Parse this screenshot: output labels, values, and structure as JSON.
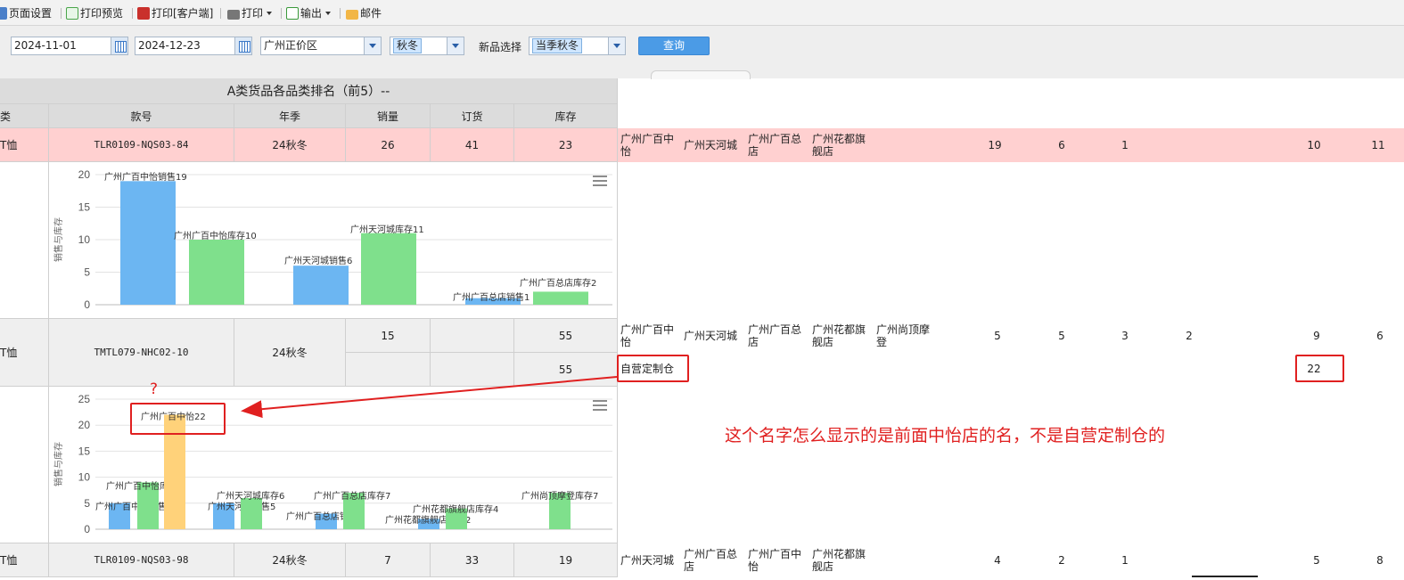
{
  "toolbar": {
    "page_setup": "页面设置",
    "print_preview": "打印预览",
    "print_client": "打印[客户端]",
    "print": "打印",
    "export": "输出",
    "mail": "邮件"
  },
  "filters": {
    "date_from": "2024-11-01",
    "date_to": "2024-12-23",
    "region": "广州正价区",
    "season": "秋冬",
    "new_label": "新品选择",
    "new_value": "当季秋冬",
    "query": "查询"
  },
  "report": {
    "title": "A类货品各品类排名（前5）--",
    "headers": {
      "cat": "类",
      "sku": "款号",
      "season": "年季",
      "sales": "销量",
      "order": "订货",
      "stock": "库存"
    },
    "rows": [
      {
        "cat": "T恤",
        "sku": "TLR0109-NQS03-84",
        "season": "24秋冬",
        "sales": "26",
        "order": "41",
        "stock": "23"
      },
      {
        "cat": "T恤",
        "sku": "TMTL079-NHC02-10",
        "season": "24秋冬",
        "sales": "15",
        "order": "",
        "stock": "55",
        "stock2": "55"
      },
      {
        "cat": "T恤",
        "sku": "TLR0109-NQS03-98",
        "season": "24秋冬",
        "sales": "7",
        "order": "33",
        "stock": "19"
      }
    ]
  },
  "right": {
    "row1": {
      "stores": [
        "广州广百中怡",
        "广州天河城",
        "广州广百总店",
        "广州花都旗舰店"
      ],
      "nums": [
        "19",
        "6",
        "1",
        "10",
        "11"
      ]
    },
    "row2": {
      "stores": [
        "广州广百中怡",
        "广州天河城",
        "广州广百总店",
        "广州花都旗舰店",
        "广州尚顶摩登"
      ],
      "nums": [
        "5",
        "5",
        "3",
        "2",
        "9",
        "6"
      ]
    },
    "row2b": {
      "store": "自营定制仓",
      "num": "22"
    },
    "row3": {
      "stores": [
        "广州天河城",
        "广州广百总店",
        "广州广百中怡",
        "广州花都旗舰店"
      ],
      "nums": [
        "4",
        "2",
        "1",
        "5",
        "8"
      ]
    }
  },
  "annotation": {
    "question": "?",
    "text": "这个名字怎么显示的是前面中怡店的名，不是自营定制仓的"
  },
  "chart_data": [
    {
      "type": "bar",
      "ylabel": "销售与库存",
      "ylim": [
        0,
        20
      ],
      "yticks": [
        "0",
        "5",
        "10",
        "15",
        "20"
      ],
      "bars": [
        {
          "label": "广州广百中怡销售19",
          "value": 19,
          "kind": "sales"
        },
        {
          "label": "广州广百中怡库存10",
          "value": 10,
          "kind": "stock"
        },
        {
          "label": "广州天河城销售6",
          "value": 6,
          "kind": "sales"
        },
        {
          "label": "广州天河城库存11",
          "value": 11,
          "kind": "stock"
        },
        {
          "label": "广州广百总店销售1",
          "value": 1,
          "kind": "sales"
        },
        {
          "label": "广州广百总店库存2",
          "value": 2,
          "kind": "stock"
        }
      ],
      "colors": {
        "sales": "#6cb6f2",
        "stock": "#7fe08c"
      }
    },
    {
      "type": "bar",
      "ylabel": "销售与库存",
      "ylim": [
        0,
        25
      ],
      "yticks": [
        "0",
        "5",
        "10",
        "15",
        "20",
        "25"
      ],
      "bars": [
        {
          "label": "广州广百中怡销售5",
          "value": 5,
          "kind": "sales"
        },
        {
          "label": "广州广百中怡库存9",
          "value": 9,
          "kind": "stock"
        },
        {
          "label": "广州广百中怡22",
          "value": 22,
          "kind": "other"
        },
        {
          "label": "广州天河城销售5",
          "value": 5,
          "kind": "sales"
        },
        {
          "label": "广州天河城库存6",
          "value": 6,
          "kind": "stock"
        },
        {
          "label": "广州广百总店销售3",
          "value": 3,
          "kind": "sales"
        },
        {
          "label": "广州广百总店库存7",
          "value": 7,
          "kind": "stock"
        },
        {
          "label": "广州花都旗舰店销售2",
          "value": 2,
          "kind": "sales"
        },
        {
          "label": "广州花都旗舰店库存4",
          "value": 4,
          "kind": "stock"
        },
        {
          "label": "广州尚顶摩登库存7",
          "value": 7,
          "kind": "stock"
        }
      ],
      "colors": {
        "sales": "#6cb6f2",
        "stock": "#7fe08c",
        "other": "#ffd27a"
      }
    }
  ]
}
